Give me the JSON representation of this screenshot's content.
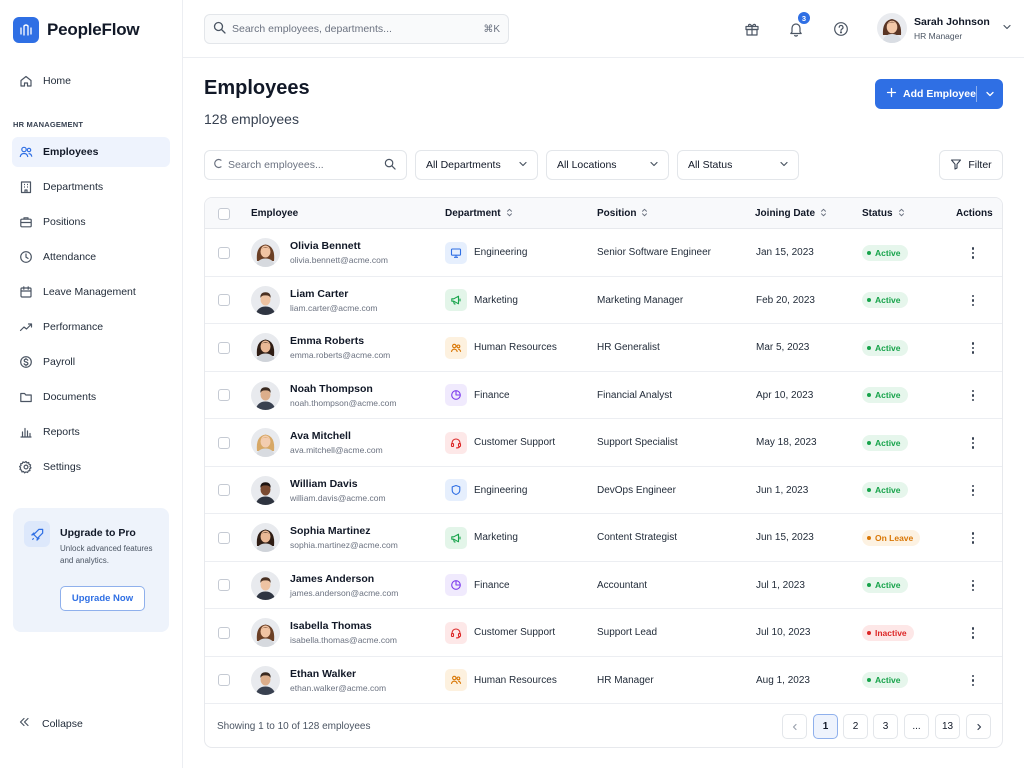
{
  "app": {
    "name": "PeopleFlow"
  },
  "sidebar": {
    "home": {
      "label": "Home",
      "icon": "home-icon"
    },
    "section_label": "HR MANAGEMENT",
    "items": [
      {
        "label": "Employees",
        "icon": "users-icon",
        "active": true
      },
      {
        "label": "Departments",
        "icon": "building-icon"
      },
      {
        "label": "Positions",
        "icon": "briefcase-icon"
      },
      {
        "label": "Attendance",
        "icon": "clock-icon"
      },
      {
        "label": "Leave Management",
        "icon": "calendar-icon"
      },
      {
        "label": "Performance",
        "icon": "trend-icon"
      },
      {
        "label": "Payroll",
        "icon": "dollar-icon"
      },
      {
        "label": "Documents",
        "icon": "folder-icon"
      },
      {
        "label": "Reports",
        "icon": "bar-chart-icon"
      },
      {
        "label": "Settings",
        "icon": "gear-icon"
      }
    ],
    "upgrade": {
      "title": "Upgrade to Pro",
      "text": "Unlock advanced features and analytics.",
      "button": "Upgrade Now"
    },
    "collapse_label": "Collapse"
  },
  "header": {
    "search_placeholder": "Search employees, departments...",
    "shortcut": "⌘K",
    "notifications_count": "3",
    "user": {
      "name": "Sarah Johnson",
      "role": "HR Manager"
    }
  },
  "main": {
    "title": "Employees",
    "subtitle": "128 employees",
    "add_button": "Add Employee",
    "filters": {
      "search_placeholder": "Search employees...",
      "department": "All Departments",
      "location": "All Locations",
      "status": "All Status",
      "filter_button": "Filter"
    }
  },
  "table": {
    "columns": {
      "employee": "Employee",
      "department": "Department",
      "position": "Position",
      "joining": "Joining Date",
      "status": "Status",
      "actions": "Actions"
    },
    "rows": [
      {
        "name": "Olivia Bennett",
        "email": "olivia.bennett@acme.com",
        "department": "Engineering",
        "dept_icon": "monitor-icon",
        "position": "Senior Software Engineer",
        "joined": "Jan 15, 2023",
        "status": "Active",
        "avatar": "f1"
      },
      {
        "name": "Liam Carter",
        "email": "liam.carter@acme.com",
        "department": "Marketing",
        "dept_icon": "megaphone-icon",
        "position": "Marketing Manager",
        "joined": "Feb 20, 2023",
        "status": "Active",
        "avatar": "m1"
      },
      {
        "name": "Emma Roberts",
        "email": "emma.roberts@acme.com",
        "department": "Human Resources",
        "dept_icon": "people-icon",
        "position": "HR Generalist",
        "joined": "Mar 5, 2023",
        "status": "Active",
        "avatar": "f2"
      },
      {
        "name": "Noah Thompson",
        "email": "noah.thompson@acme.com",
        "department": "Finance",
        "dept_icon": "pie-icon",
        "position": "Financial Analyst",
        "joined": "Apr 10, 2023",
        "status": "Active",
        "avatar": "m2"
      },
      {
        "name": "Ava Mitchell",
        "email": "ava.mitchell@acme.com",
        "department": "Customer Support",
        "dept_icon": "headset-icon",
        "position": "Support Specialist",
        "joined": "May 18, 2023",
        "status": "Active",
        "avatar": "f3"
      },
      {
        "name": "William Davis",
        "email": "william.davis@acme.com",
        "department": "Engineering",
        "dept_icon": "shield-icon",
        "position": "DevOps Engineer",
        "joined": "Jun 1, 2023",
        "status": "Active",
        "avatar": "m3"
      },
      {
        "name": "Sophia Martinez",
        "email": "sophia.martinez@acme.com",
        "department": "Marketing",
        "dept_icon": "megaphone-icon",
        "position": "Content Strategist",
        "joined": "Jun 15, 2023",
        "status": "On Leave",
        "avatar": "f2"
      },
      {
        "name": "James Anderson",
        "email": "james.anderson@acme.com",
        "department": "Finance",
        "dept_icon": "pie-icon",
        "position": "Accountant",
        "joined": "Jul 1, 2023",
        "status": "Active",
        "avatar": "m1"
      },
      {
        "name": "Isabella Thomas",
        "email": "isabella.thomas@acme.com",
        "department": "Customer Support",
        "dept_icon": "headset-icon",
        "position": "Support Lead",
        "joined": "Jul 10, 2023",
        "status": "Inactive",
        "avatar": "f1"
      },
      {
        "name": "Ethan Walker",
        "email": "ethan.walker@acme.com",
        "department": "Human Resources",
        "dept_icon": "people-icon",
        "position": "HR Manager",
        "joined": "Aug 1, 2023",
        "status": "Active",
        "avatar": "m2"
      }
    ],
    "footer": {
      "showing": "Showing 1 to 10 of 128 employees",
      "pages": [
        "1",
        "2",
        "3",
        "...",
        "13"
      ],
      "current_page": "1"
    }
  },
  "colors": {
    "accent": "#2f6fe4",
    "active": "#16a34a",
    "on_leave": "#d97706",
    "inactive": "#dc2626"
  }
}
